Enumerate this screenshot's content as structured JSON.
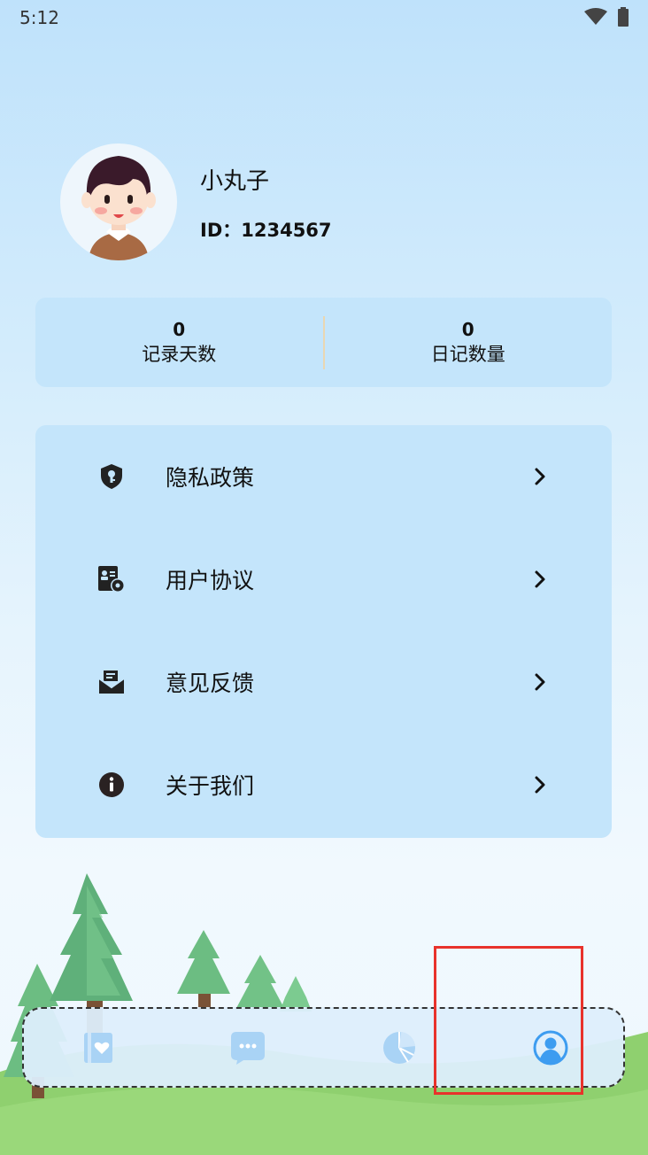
{
  "status_bar": {
    "time": "5:12",
    "icons": [
      "wifi-icon",
      "battery-icon"
    ]
  },
  "profile": {
    "nickname": "小丸子",
    "id_text": "ID：1234567"
  },
  "stats": [
    {
      "value": "0",
      "label": "记录天数"
    },
    {
      "value": "0",
      "label": "日记数量"
    }
  ],
  "menu": [
    {
      "label": "隐私政策",
      "icon": "shield-key-icon"
    },
    {
      "label": "用户协议",
      "icon": "user-agreement-icon"
    },
    {
      "label": "意见反馈",
      "icon": "mail-feedback-icon"
    },
    {
      "label": "关于我们",
      "icon": "info-icon"
    }
  ],
  "bottom_nav": [
    {
      "icon": "diary-book-icon",
      "active": false
    },
    {
      "icon": "chat-bubble-icon",
      "active": false
    },
    {
      "icon": "pie-chart-icon",
      "active": false
    },
    {
      "icon": "profile-icon",
      "active": true
    }
  ],
  "colors": {
    "card_bg": "#c4e5fb",
    "nav_active": "#3d9cf0",
    "nav_inactive": "#a9d3f5",
    "highlight": "#e8322b"
  }
}
